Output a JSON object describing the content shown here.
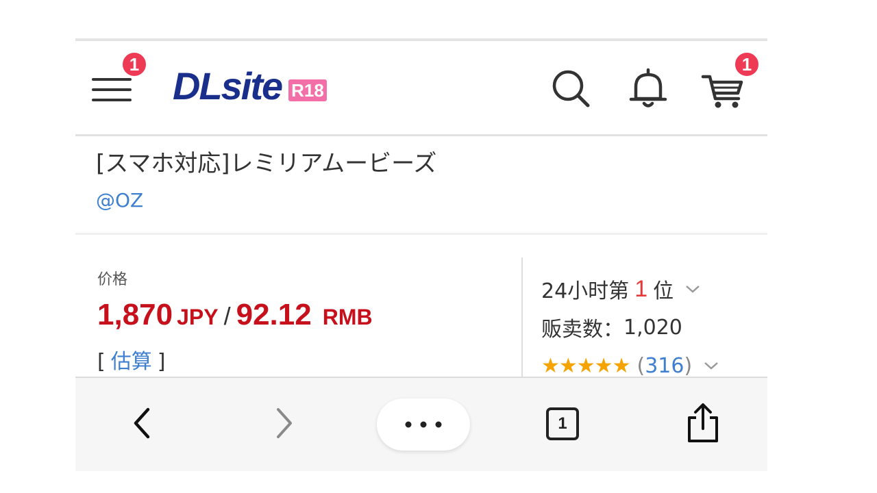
{
  "header": {
    "menu_badge": "1",
    "logo_text": "DLsite",
    "logo_badge": "R18",
    "cart_badge": "1"
  },
  "product": {
    "title": "[スマホ対応]レミリアムービーズ",
    "circle": "@OZ"
  },
  "price": {
    "label": "价格",
    "jpy_value": "1,870",
    "jpy_unit": "JPY",
    "separator": "/",
    "rmb_value": "92.12",
    "rmb_unit": "RMB",
    "estimate_open": "[",
    "estimate_link": "估算",
    "estimate_close": "]"
  },
  "stats": {
    "rank_prefix": "24小时第",
    "rank_number": "1",
    "rank_suffix": "位",
    "sales_label": "贩卖数：",
    "sales_value": "1,020",
    "stars": "★★★★★",
    "rating_stars": 5,
    "review_open": "(",
    "review_count": "316",
    "review_close": ")"
  },
  "toolbar": {
    "tab_count": "1"
  },
  "icons": {
    "menu": "hamburger-menu-icon",
    "search": "search-icon",
    "notification": "bell-icon",
    "cart": "cart-icon",
    "back": "chevron-left-icon",
    "forward": "chevron-right-icon",
    "more": "ellipsis-icon",
    "tabs": "tabs-icon",
    "share": "share-icon"
  },
  "colors": {
    "brand": "#1a2f8c",
    "r18_badge": "#f36fa7",
    "badge": "#ee3a55",
    "price": "#c6101c",
    "link": "#3f7fd0",
    "star": "#f5a300"
  }
}
